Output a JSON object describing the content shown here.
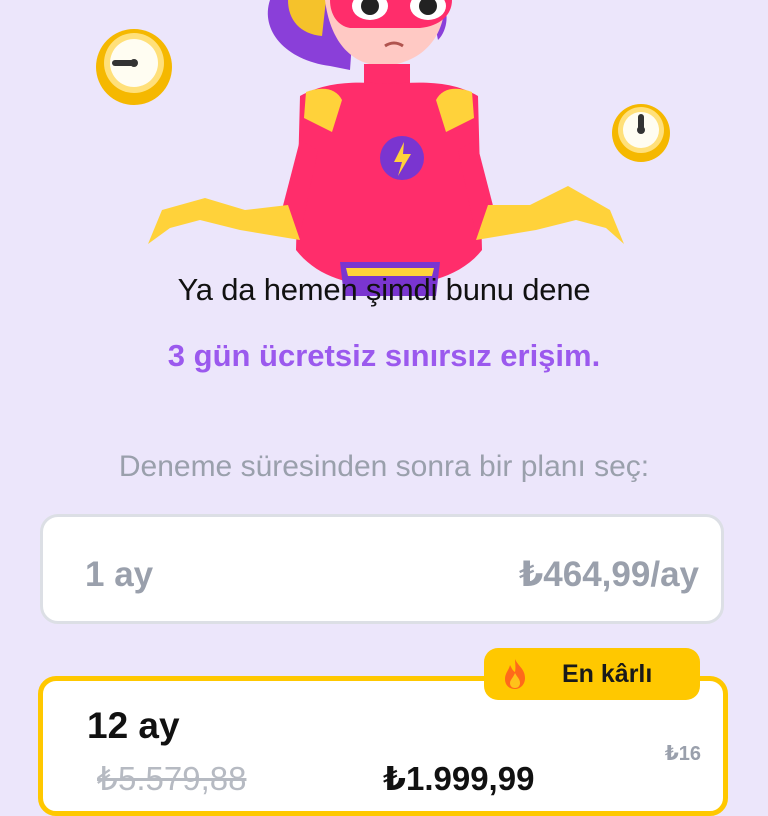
{
  "promo": {
    "heading": "Ya da hemen şimdi bunu dene",
    "subheading": "3 gün ücretsiz sınırsız erişim."
  },
  "plans": {
    "hint": "Deneme süresinden sonra bir planı seç:",
    "monthly": {
      "duration": "1 ay",
      "price": "₺464,99/ay"
    },
    "yearly": {
      "badge": "En kârlı",
      "duration": "12 ay",
      "old_price": "₺5.579,88",
      "price": "₺1.999,99",
      "per_month": "₺16"
    }
  },
  "icons": [
    "clock-icon",
    "fire-icon"
  ],
  "colors": {
    "background": "#ece6fb",
    "accent": "#9b59ee",
    "badge": "#ffc800"
  }
}
